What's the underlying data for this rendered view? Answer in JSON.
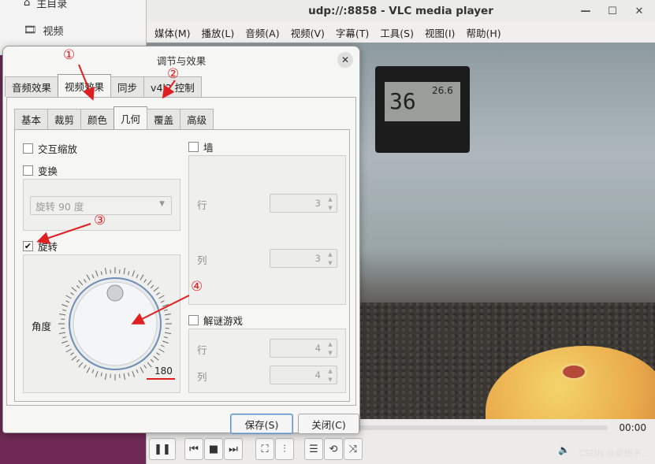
{
  "background": {
    "items": [
      {
        "label": "主目录",
        "icon": "home-icon"
      },
      {
        "label": "视频",
        "icon": "film-icon"
      }
    ]
  },
  "vlc": {
    "title": "udp://:8858 - VLC media player",
    "menu": [
      "媒体(M)",
      "播放(L)",
      "音频(A)",
      "视频(V)",
      "字幕(T)",
      "工具(S)",
      "视图(I)",
      "帮助(H)"
    ],
    "time": "00:00",
    "thermo_temp": "26.6",
    "thermo_hum": "36",
    "watermark": "CSDN @意想不...",
    "volume_icon": "speaker-icon"
  },
  "dialog": {
    "title": "调节与效果",
    "tabs": [
      "音频效果",
      "视频效果",
      "同步",
      "v4l2 控制"
    ],
    "active_tab": "视频效果",
    "subtabs": [
      "基本",
      "裁剪",
      "颜色",
      "几何",
      "覆盖",
      "高级"
    ],
    "active_subtab": "几何",
    "interactive_zoom": {
      "label": "交互缩放",
      "checked": false
    },
    "transform": {
      "label": "变换",
      "checked": false,
      "select_value": "旋转 90 度"
    },
    "rotate": {
      "label": "旋转",
      "checked": true,
      "angle_label": "角度",
      "angle_value": "180"
    },
    "wall": {
      "label": "墙",
      "checked": false,
      "rows_label": "行",
      "rows": "3",
      "cols_label": "列",
      "cols": "3"
    },
    "puzzle": {
      "label": "解谜游戏",
      "checked": false,
      "rows_label": "行",
      "rows": "4",
      "cols_label": "列",
      "cols": "4"
    },
    "save_label": "保存(S)",
    "close_label": "关闭(C)"
  },
  "annotations": [
    "①",
    "②",
    "③",
    "④"
  ],
  "colors": {
    "annotation": "#e02020",
    "checkbox_check": "#111111"
  }
}
